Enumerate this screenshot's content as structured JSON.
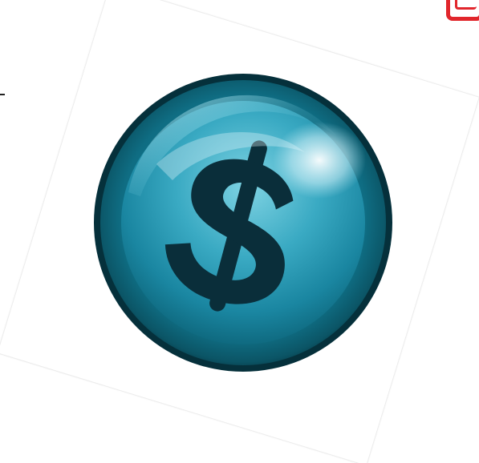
{
  "image": {
    "subject": "dollar-coin-button",
    "symbol": "$",
    "colors": {
      "background": "#ffffff",
      "coin_outer": "#0b5b6d",
      "coin_mid": "#1a8aa4",
      "coin_light": "#5cc3d7",
      "coin_glow": "#d8f4fb",
      "symbol": "#0a2e3a",
      "corner_mark": "#e1262c"
    },
    "icons": [
      "dollar-sign-icon",
      "corner-logo-icon"
    ]
  }
}
